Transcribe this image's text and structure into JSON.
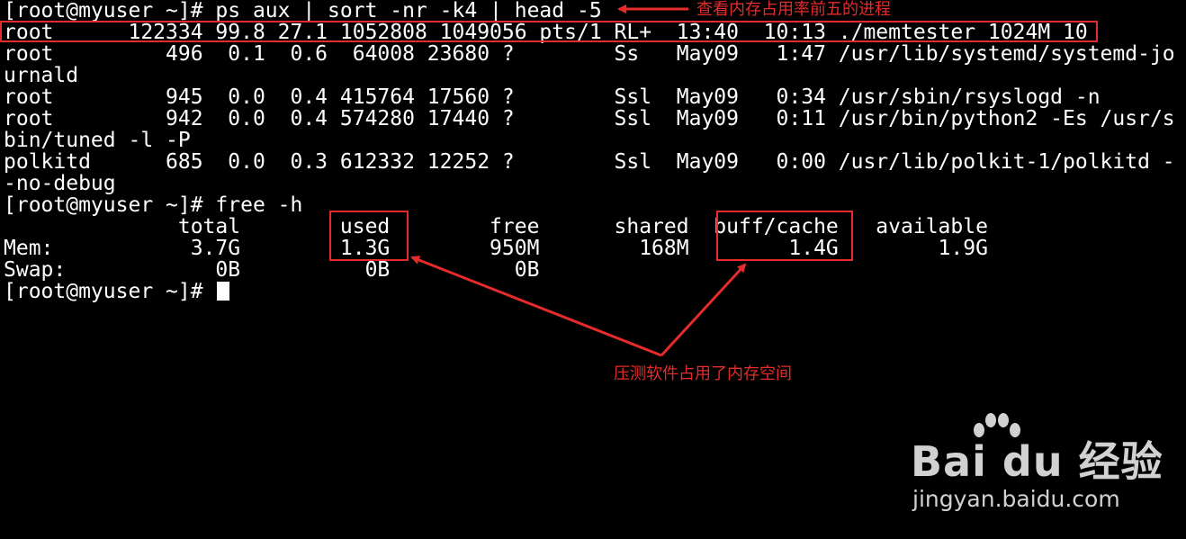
{
  "terminal": {
    "lines": [
      "[root@myuser ~]# ps aux | sort -nr -k4 | head -5",
      "root      122334 99.8 27.1 1052808 1049056 pts/1 RL+  13:40  10:13 ./memtester 1024M 10",
      "root         496  0.1  0.6  64008 23680 ?        Ss   May09   1:47 /usr/lib/systemd/systemd-jo",
      "urnald",
      "root         945  0.0  0.4 415764 17560 ?        Ssl  May09   0:34 /usr/sbin/rsyslogd -n",
      "root         942  0.0  0.4 574280 17440 ?        Ssl  May09   0:11 /usr/bin/python2 -Es /usr/s",
      "bin/tuned -l -P",
      "polkitd      685  0.0  0.3 612332 12252 ?        Ssl  May09   0:00 /usr/lib/polkit-1/polkitd -",
      "-no-debug",
      "[root@myuser ~]# free -h",
      "              total        used        free      shared  buff/cache   available",
      "Mem:           3.7G        1.3G        950M        168M        1.4G        1.9G",
      "Swap:            0B          0B          0B"
    ],
    "prompt": "[root@myuser ~]# "
  },
  "annotations": {
    "top_note": "查看内存占用率前五的进程",
    "bottom_note": "压测软件占用了内存空间",
    "color": "#e52b2b"
  },
  "watermark": {
    "logo_text": "Bai du 经验",
    "url": "jingyan.baidu.com"
  }
}
